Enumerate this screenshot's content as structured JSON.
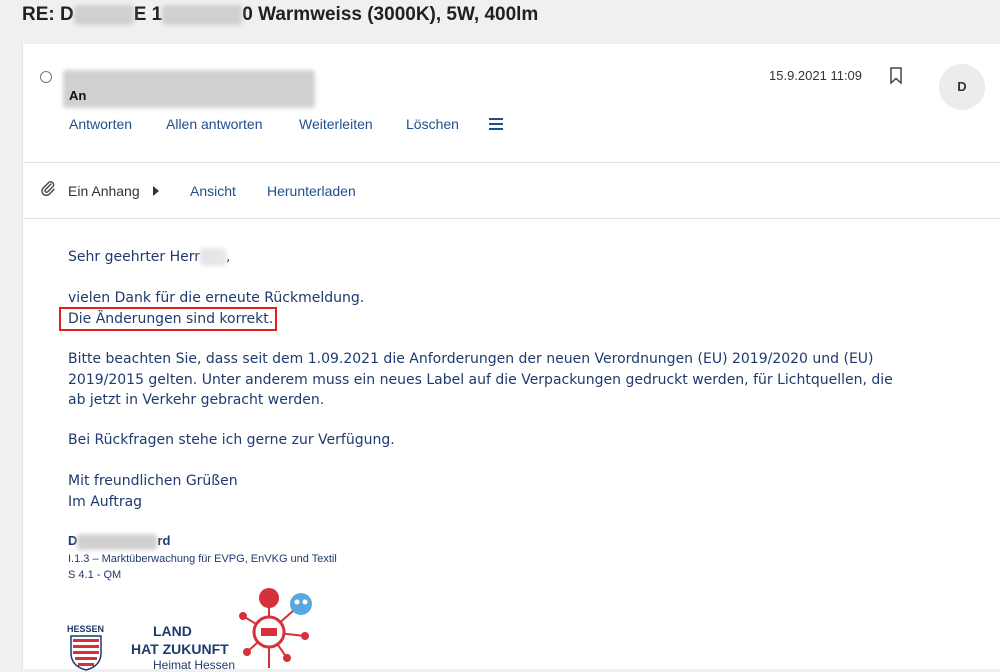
{
  "subject": {
    "prefix": "RE: D",
    "mid": "E 1",
    "suffix": "0 Warmweiss (3000K), 5W, 400lm"
  },
  "message": {
    "to_label": "An",
    "date": "15.9.2021 11:09",
    "avatar_initial": "D",
    "actions": [
      "Antworten",
      "Allen antworten",
      "Weiterleiten",
      "Löschen"
    ],
    "menu_icon": "hamburger-menu-icon",
    "bookmark_icon": "bookmark-icon"
  },
  "attachments": {
    "label": "Ein Anhang",
    "view": "Ansicht",
    "download": "Herunterladen",
    "icon": "paperclip-icon"
  },
  "body": {
    "greeting": "Sehr geehrter Herr",
    "greeting_end": ",",
    "p1_line1": "vielen Dank für die erneute Rückmeldung.",
    "p1_line2": "Die Änderungen sind korrekt.",
    "p2_line1": "Bitte beachten Sie, dass seit dem 1.09.2021 die Anforderungen der neuen Verordnungen (EU) 2019/2020 und (EU)",
    "p2_line2": "2019/2015 gelten. Unter anderem muss ein neues Label auf die Verpackungen gedruckt werden, für Lichtquellen, die",
    "p2_line3": "ab jetzt in Verkehr gebracht werden.",
    "p3": "Bei Rückfragen stehe ich gerne zur Verfügung.",
    "closing1": "Mit freundlichen Grüßen",
    "closing2": "Im Auftrag"
  },
  "signature": {
    "name_start": "D",
    "name_end": "rd",
    "line1": "I.1.3 – Marktüberwachung für EVPG, EnVKG und Textil",
    "line2": "S 4.1 - QM",
    "logo_state": "HESSEN",
    "logo_line1": "LAND",
    "logo_line2": "HAT ZUKUNFT",
    "logo_line3": "Heimat Hessen"
  },
  "colors": {
    "link": "#1e4f8c",
    "body_text": "#1e3a6e",
    "highlight": "#e02020",
    "logo_red": "#d6303c",
    "logo_blue": "#5aa7de"
  }
}
